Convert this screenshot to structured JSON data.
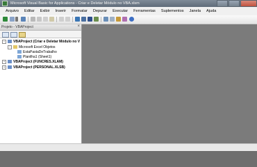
{
  "window": {
    "title": "Microsoft Visual Basic for Applications - Criar e Deletar Módulo no VBA.xlsm"
  },
  "menu": [
    "Arquivo",
    "Editar",
    "Exibir",
    "Inserir",
    "Formatar",
    "Depurar",
    "Executar",
    "Ferramentas",
    "Suplementos",
    "Janela",
    "Ajuda"
  ],
  "project_pane": {
    "title": "Projeto - VBAProject",
    "close": "×"
  },
  "tree": {
    "root1": "VBAProject (Criar e Deletar Módulo no V",
    "folder1": "Microsoft Excel Objetos",
    "item1": "EstaPastaDeTrabalho",
    "item2": "Planilha1 (Sheet1)",
    "root2": "VBAProject (FUNCRES.XLAM)",
    "root3": "VBAProject (PERSONAL.XLSB)",
    "expanded": "−",
    "collapsed": "+"
  },
  "colors": {
    "mdi_background": "#7b7b7b",
    "titlebar": "#6f7b88"
  }
}
